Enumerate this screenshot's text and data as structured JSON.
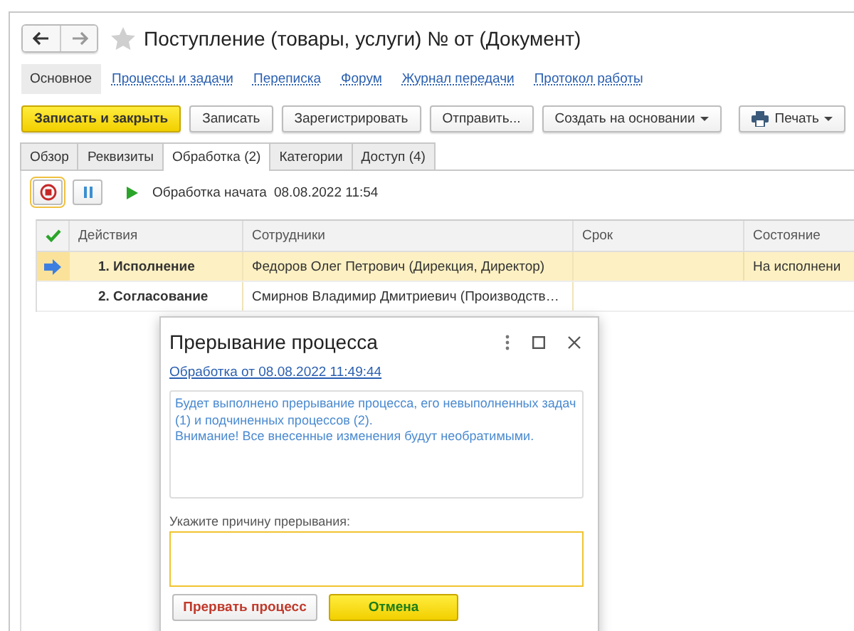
{
  "window": {
    "title": "Поступление (товары, услуги) № от (Документ)",
    "favorite": false
  },
  "nav": [
    {
      "label": "Основное",
      "selected": true
    },
    {
      "label": "Процессы и задачи",
      "selected": false
    },
    {
      "label": "Переписка",
      "selected": false
    },
    {
      "label": "Форум",
      "selected": false
    },
    {
      "label": "Журнал передачи",
      "selected": false
    },
    {
      "label": "Протокол работы",
      "selected": false
    }
  ],
  "toolbar": [
    {
      "label": "Записать и закрыть",
      "kind": "primary"
    },
    {
      "label": "Записать",
      "kind": "plain"
    },
    {
      "label": "Зарегистрировать",
      "kind": "plain"
    },
    {
      "label": "Отправить...",
      "kind": "plain"
    },
    {
      "label": "Создать на основании",
      "kind": "dropdown"
    },
    {
      "label": "Печать",
      "kind": "print"
    }
  ],
  "tabs": [
    {
      "label": "Обзор",
      "selected": false
    },
    {
      "label": "Реквизиты",
      "selected": false
    },
    {
      "label": "Обработка (2)",
      "selected": true
    },
    {
      "label": "Категории",
      "selected": false
    },
    {
      "label": "Доступ (4)",
      "selected": false
    }
  ],
  "process": {
    "status": "Обработка начата",
    "date": "08.08.2022 11:54"
  },
  "table": {
    "columns": [
      "Действия",
      "Сотрудники",
      "Срок",
      "Состояние"
    ],
    "rows": [
      {
        "selected": true,
        "current": true,
        "action": "1. Исполнение",
        "employee": "Федоров Олег Петрович (Дирекция, Директор)",
        "state": "На исполнени"
      },
      {
        "selected": false,
        "current": false,
        "action": "2. Согласование",
        "employee": "Смирнов Владимир Дмитриевич (Производств…"
      }
    ]
  },
  "dialog": {
    "title": "Прерывание процесса",
    "link": "Обработка от 08.08.2022 11:49:44",
    "message": "Будет выполнено прерывание процесса, его невыполненных задач (1) и подчиненных процессов (2).\nВнимание! Все внесенные изменения будут необратимыми.",
    "reason_label": "Укажите причину прерывания:",
    "buttons": [
      {
        "label": "Прервать процесс",
        "kind": "danger"
      },
      {
        "label": "Отмена",
        "kind": "default"
      }
    ]
  }
}
